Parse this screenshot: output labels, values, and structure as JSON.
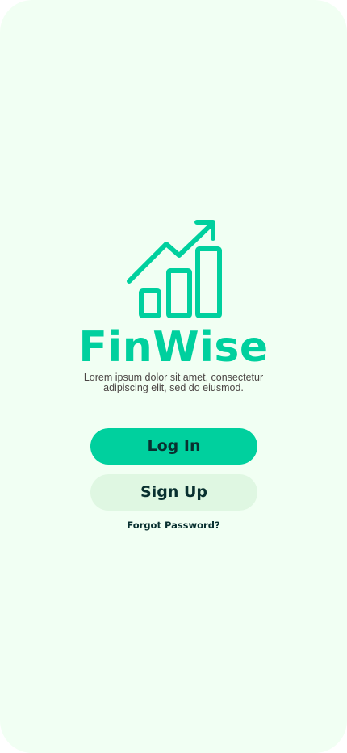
{
  "app": {
    "name": "FinWise",
    "tagline": "Lorem ipsum dolor sit amet, consectetur adipiscing elit, sed do eiusmod.",
    "logo_icon": "growth-chart-icon"
  },
  "actions": {
    "login_label": "Log In",
    "signup_label": "Sign Up",
    "forgot_label": "Forgot Password?"
  },
  "colors": {
    "background": "#F1FFF3",
    "primary": "#00D09E",
    "secondary_button": "#DFF7E2",
    "dark_text": "#093030",
    "body_text": "#4B4544"
  }
}
